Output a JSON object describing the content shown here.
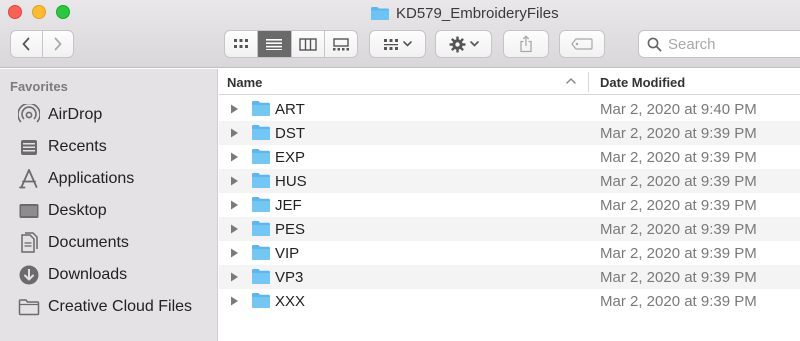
{
  "window": {
    "title": "KD579_EmbroideryFiles"
  },
  "toolbar": {
    "search_placeholder": "Search",
    "view_modes": [
      "icon-view",
      "list-view",
      "column-view",
      "gallery-view"
    ],
    "active_view": "list-view"
  },
  "sidebar": {
    "heading": "Favorites",
    "items": [
      {
        "label": "AirDrop",
        "icon": "airdrop-icon"
      },
      {
        "label": "Recents",
        "icon": "recents-icon"
      },
      {
        "label": "Applications",
        "icon": "applications-icon"
      },
      {
        "label": "Desktop",
        "icon": "desktop-icon"
      },
      {
        "label": "Documents",
        "icon": "documents-icon"
      },
      {
        "label": "Downloads",
        "icon": "downloads-icon"
      },
      {
        "label": "Creative Cloud Files",
        "icon": "folder-icon"
      }
    ]
  },
  "list": {
    "columns": {
      "name": "Name",
      "date": "Date Modified"
    },
    "rows": [
      {
        "name": "ART",
        "date": "Mar 2, 2020 at 9:40 PM"
      },
      {
        "name": "DST",
        "date": "Mar 2, 2020 at 9:39 PM"
      },
      {
        "name": "EXP",
        "date": "Mar 2, 2020 at 9:39 PM"
      },
      {
        "name": "HUS",
        "date": "Mar 2, 2020 at 9:39 PM"
      },
      {
        "name": "JEF",
        "date": "Mar 2, 2020 at 9:39 PM"
      },
      {
        "name": "PES",
        "date": "Mar 2, 2020 at 9:39 PM"
      },
      {
        "name": "VIP",
        "date": "Mar 2, 2020 at 9:39 PM"
      },
      {
        "name": "VP3",
        "date": "Mar 2, 2020 at 9:39 PM"
      },
      {
        "name": "XXX",
        "date": "Mar 2, 2020 at 9:39 PM"
      }
    ]
  },
  "colors": {
    "folder": "#5bb8ee",
    "sidebar_bg": "#e4e2e4",
    "row_alt": "#f4f4f5",
    "active_view_bg": "#6a6a6a"
  }
}
